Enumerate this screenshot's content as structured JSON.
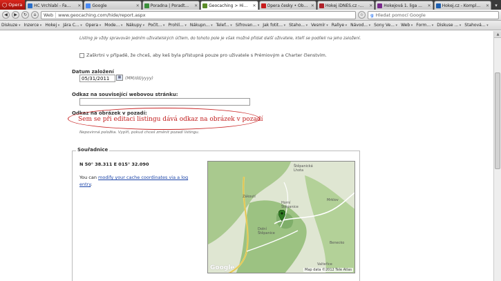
{
  "browser": {
    "menu_label": "Opera",
    "tabs": [
      {
        "title": "HC Vrchlabí - Fa...",
        "color": "#2a6fc9",
        "active": false
      },
      {
        "title": "Google",
        "color": "#4a8af4",
        "active": false
      },
      {
        "title": "Poradna | Poradt...",
        "color": "#3b8f3b",
        "active": false
      },
      {
        "title": "Geocaching > Hi...",
        "color": "#5b8c2a",
        "active": true
      },
      {
        "title": "Opera česky • Ob...",
        "color": "#c81c1c",
        "active": false
      },
      {
        "title": "Hokej iDNES.cz -...",
        "color": "#b0222a",
        "active": false
      },
      {
        "title": "Hokejová 1. liga ...",
        "color": "#7a2a8c",
        "active": false
      },
      {
        "title": "Hokej.cz - Kompl...",
        "color": "#1d5fb0",
        "active": false
      }
    ],
    "address": {
      "mode": "Web",
      "url": "www.geocaching.com/hide/report.aspx"
    },
    "search_placeholder": "Hledat pomocí Google",
    "bookmarks": [
      "Diskuze",
      "Inzerce",
      "Hokej",
      "Jára C...",
      "Opera",
      "Mode...",
      "Nákupy",
      "Počít...",
      "Prohlí...",
      "Nákupn...",
      "Telef...",
      "Sifrovan...",
      "Jak fotit...",
      "Staho...",
      "Vesmír",
      "Rallye",
      "Návod...",
      "Sony Ve...",
      "Web",
      "Form...",
      "Diskuse ...",
      "Stahová..."
    ]
  },
  "form": {
    "note": "Listing je vždy spravován jedním uživatelských účtem, do tohoto pole je však možné přidat další uživatele, kteří se podíleli na jeho založení.",
    "premium_checkbox": "Zaškrtni v případě, že chceš, aby keš byla přístupná pouze pro uživatele s Prémiovým a Charter členstvím.",
    "date_label": "Datum založení",
    "date_value": "05/31/2011",
    "date_hint": "(MM/dd/yyyy)",
    "related_label": "Odkaz na související webovou stránku:",
    "background_label": "Odkaz na obrázek v pozadí:",
    "background_hint": "Nepovinná položka. Vyplň, pokud chceš změnit pozadí listingu.",
    "annotation": "Sem se při editaci listingu dává odkaz na obrázek v pozadí"
  },
  "coordinates": {
    "legend": "Souřadnice",
    "value": "N 50° 38.311 E 015° 32.090",
    "you_can": "You can ",
    "link": "modify your cache coordinates via a log entry",
    "period": "."
  },
  "map": {
    "places": [
      "Štěpanická Lhota",
      "Zákoutí",
      "Horní Štěpanice",
      "Dolní Štěpanice",
      "Mrklov",
      "Benecko",
      "Valteřice"
    ],
    "google": "Google",
    "footer": "Map data ©2012 Tele Atlas"
  }
}
